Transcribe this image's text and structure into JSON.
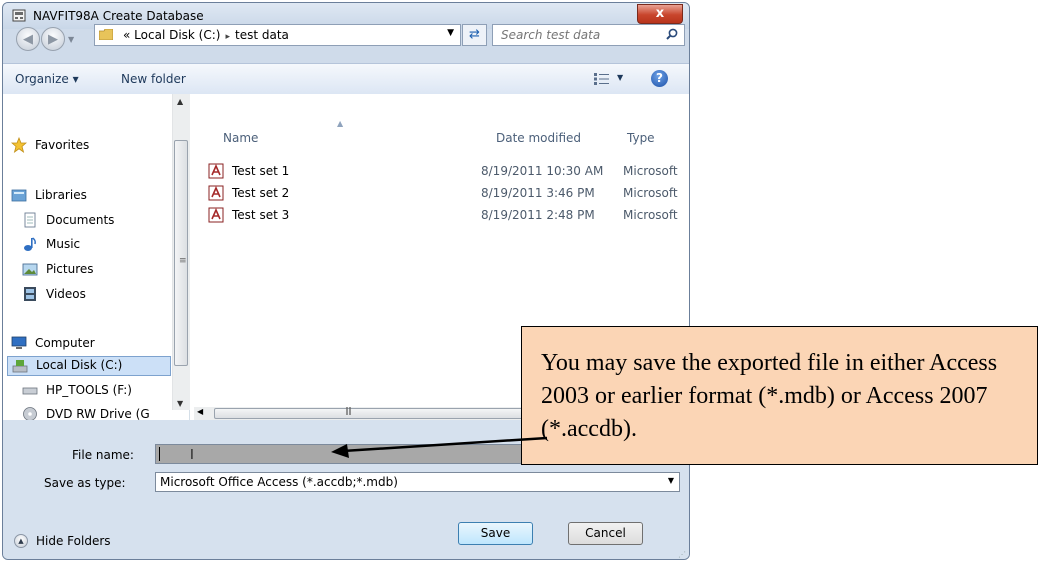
{
  "window": {
    "title": "NAVFIT98A Create Database",
    "close_label": "x"
  },
  "address": {
    "prefix": "«",
    "crumbs": [
      "Local Disk (C:)",
      "test data"
    ],
    "separator": "▸"
  },
  "search": {
    "placeholder": "Search test data"
  },
  "toolbar": {
    "organize_label": "Organize ▾",
    "new_folder_label": "New folder",
    "help_label": "?"
  },
  "nav": {
    "favorites": "Favorites",
    "libraries": "Libraries",
    "documents": "Documents",
    "music": "Music",
    "pictures": "Pictures",
    "videos": "Videos",
    "computer": "Computer",
    "local_disk": "Local Disk (C:)",
    "hp_tools": "HP_TOOLS (F:)",
    "dvd": "DVD RW Drive (G"
  },
  "columns": {
    "name": "Name",
    "date_modified": "Date modified",
    "type": "Type"
  },
  "files": [
    {
      "name": "Test set 1",
      "date": "8/19/2011 10:30 AM",
      "type": "Microsoft"
    },
    {
      "name": "Test set 2",
      "date": "8/19/2011 3:46 PM",
      "type": "Microsoft"
    },
    {
      "name": "Test set 3",
      "date": "8/19/2011 2:48 PM",
      "type": "Microsoft"
    }
  ],
  "form": {
    "file_name_label": "File name:",
    "file_name_value": "",
    "save_as_type_label": "Save as type:",
    "save_as_type_value": "Microsoft Office Access (*.accdb;*.mdb)"
  },
  "buttons": {
    "hide_folders": "Hide Folders",
    "save": "Save",
    "cancel": "Cancel"
  },
  "callout": {
    "text": "You may save the exported file in either Access 2003 or earlier format (*.mdb) or Access 2007 (*.accdb)."
  },
  "colors": {
    "callout_fill": "#fbd5b5",
    "close_button": "#c8452c",
    "selection": "#cce0f7"
  }
}
